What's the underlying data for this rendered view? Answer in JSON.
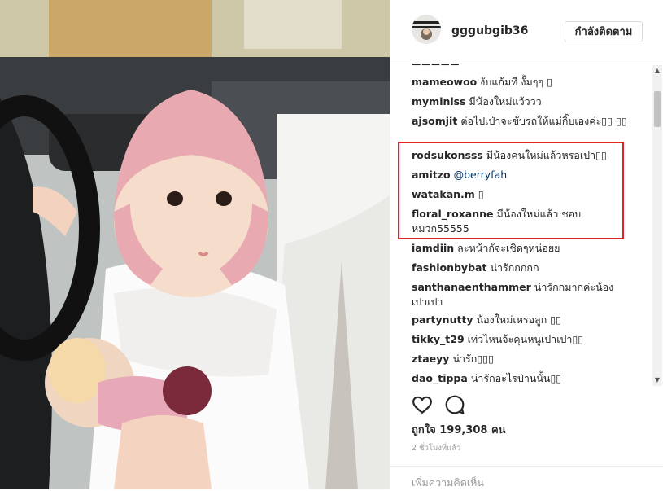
{
  "header": {
    "username": "gggubgib36",
    "follow_label": "กำลังติดตาม"
  },
  "comments": [
    {
      "user": "mameowoo",
      "text": "งับแก้มที งั้มๆๆ ▯"
    },
    {
      "user": "myminiss",
      "text": "มีน้องใหม่แว้ววว"
    },
    {
      "user": "ajsomjit",
      "text": "ต่อไปเป่าจะขับรถให้แม่กิ๊บเองค่ะ▯▯ ▯▯"
    },
    {
      "user": "rodsukonsss",
      "text": "มีน้องคนใหม่แล้วหรอเปา▯▯"
    },
    {
      "user": "amitzo",
      "text": "",
      "mention": "@berryfah"
    },
    {
      "user": "watakan.m",
      "text": "▯"
    },
    {
      "user": "floral_roxanne",
      "text": "มีน้องใหม่แล้ว ชอบหมวก55555"
    },
    {
      "user": "iamdiin",
      "text": "ละหน้ากัจะเชิดๆหน่อยย"
    },
    {
      "user": "fashionbybat",
      "text": "น่ารักกกกก"
    },
    {
      "user": "santhanaenthammer",
      "text": "น่ารักกมากค่ะน้องเปาเปา"
    },
    {
      "user": "partynutty",
      "text": "น้องใหม่เหรอลูก ▯▯"
    },
    {
      "user": "tikky_t29",
      "text": "เท่วไหนจ้ะคุนหนูเปาเปา▯▯"
    },
    {
      "user": "ztaeyy",
      "text": "น่ารัก▯▯▯"
    },
    {
      "user": "dao_tippa",
      "text": "น่ารักอะไรป่านนั้น▯▯"
    }
  ],
  "likes": "ถูกใจ 199,308 คน",
  "time_ago": "2 ชั่วโมงที่แล้ว",
  "add_comment_placeholder": "เพิ่มความคิดเห็น",
  "icons": {
    "like": "heart-icon",
    "comment": "comment-icon"
  },
  "colors": {
    "highlight": "#e0242c",
    "mention": "#003569"
  }
}
